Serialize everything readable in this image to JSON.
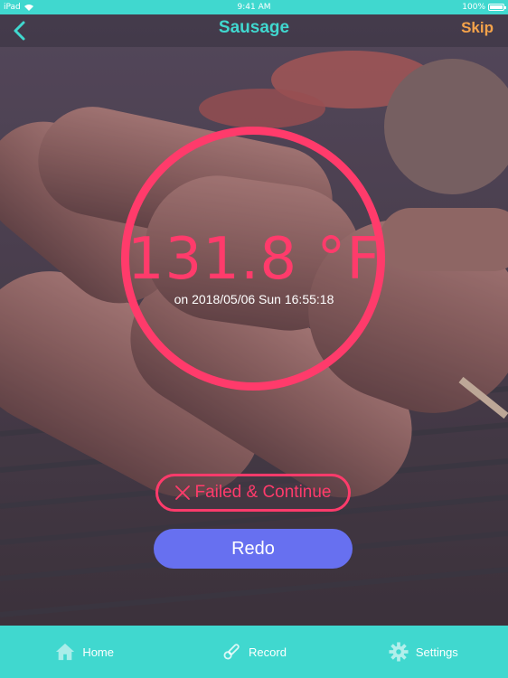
{
  "status_bar": {
    "device": "iPad",
    "time": "9:41 AM",
    "battery": "100%"
  },
  "nav": {
    "title": "Sausage",
    "skip_label": "Skip"
  },
  "reading": {
    "temperature": "131.8 °F",
    "timestamp": "on 2018/05/06 Sun 16:55:18"
  },
  "actions": {
    "failed_label": "Failed & Continue",
    "redo_label": "Redo"
  },
  "tabs": [
    {
      "label": "Home",
      "icon": "home-icon"
    },
    {
      "label": "Record",
      "icon": "thermometer-icon"
    },
    {
      "label": "Settings",
      "icon": "gear-icon"
    }
  ],
  "colors": {
    "accent_teal": "#40d8cf",
    "accent_pink": "#ff3b6b",
    "redo_blue": "#6770f0",
    "skip_orange": "#f4a24a"
  }
}
